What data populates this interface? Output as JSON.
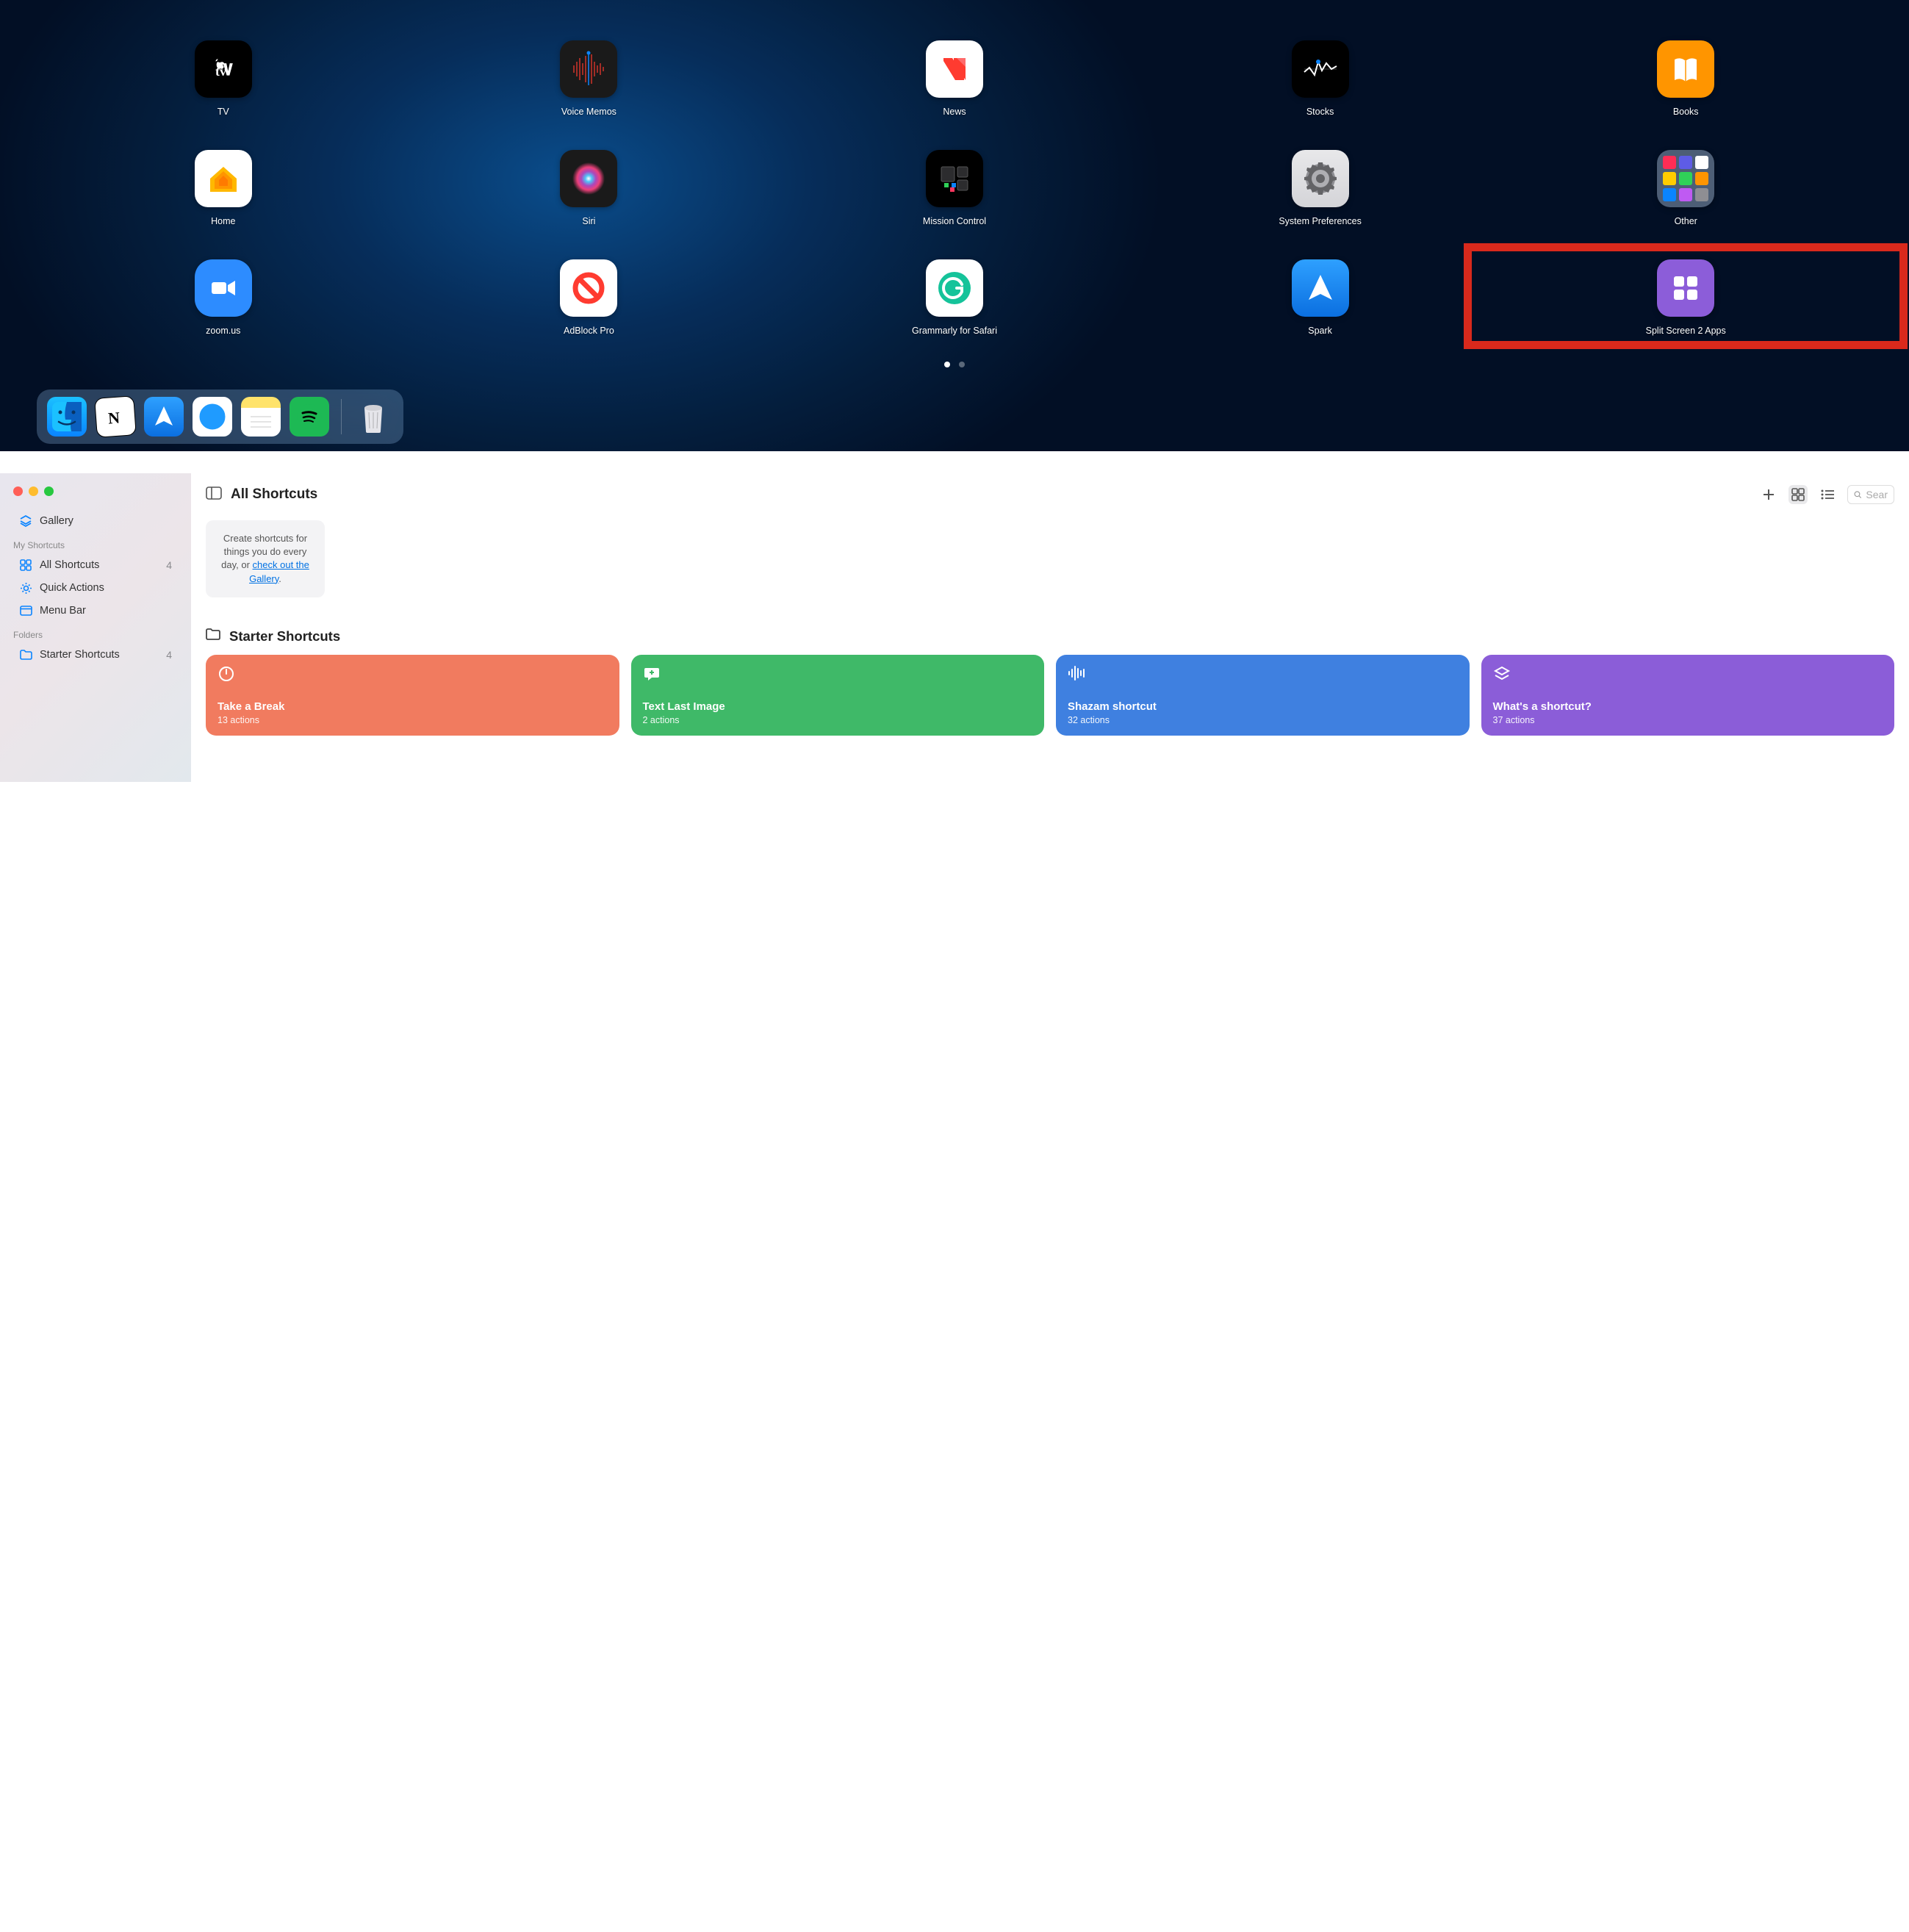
{
  "launchpad": {
    "apps": [
      {
        "label": "TV"
      },
      {
        "label": "Voice Memos"
      },
      {
        "label": "News"
      },
      {
        "label": "Stocks"
      },
      {
        "label": "Books"
      },
      {
        "label": "Home"
      },
      {
        "label": "Siri"
      },
      {
        "label": "Mission Control"
      },
      {
        "label": "System Preferences"
      },
      {
        "label": "Other"
      },
      {
        "label": "zoom.us"
      },
      {
        "label": "AdBlock Pro"
      },
      {
        "label": "Grammarly for Safari"
      },
      {
        "label": "Spark"
      },
      {
        "label": "Split Screen 2 Apps"
      }
    ],
    "dock": [
      "Finder",
      "Notion",
      "Spark",
      "Safari",
      "Notes",
      "Spotify",
      "Trash"
    ]
  },
  "shortcuts": {
    "sidebar": {
      "gallery": "Gallery",
      "section_my": "My Shortcuts",
      "all": {
        "label": "All Shortcuts",
        "count": "4"
      },
      "quick": {
        "label": "Quick Actions"
      },
      "menubar": {
        "label": "Menu Bar"
      },
      "section_folders": "Folders",
      "starter": {
        "label": "Starter Shortcuts",
        "count": "4"
      }
    },
    "header": {
      "title": "All Shortcuts",
      "search_placeholder": "Sear"
    },
    "hint": {
      "line1": "Create shortcuts for things you do every day, or ",
      "link": "check out the Gallery",
      "tail": "."
    },
    "starter_title": "Starter Shortcuts",
    "cards": [
      {
        "title": "Take a Break",
        "sub": "13 actions",
        "color": "#f17b5f"
      },
      {
        "title": "Text Last Image",
        "sub": "2 actions",
        "color": "#3fb968"
      },
      {
        "title": "Shazam shortcut",
        "sub": "32 actions",
        "color": "#3f80e0"
      },
      {
        "title": "What's a shortcut?",
        "sub": "37 actions",
        "color": "#8b5dd8"
      }
    ]
  }
}
